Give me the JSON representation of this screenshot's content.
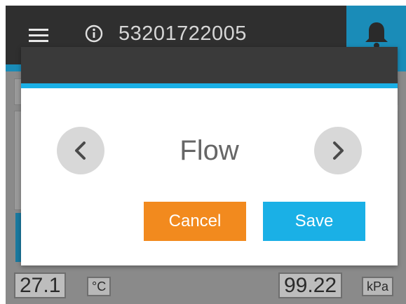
{
  "header": {
    "device_id": "53201722005",
    "menu_icon": "hamburger-menu-icon",
    "info_icon": "info-icon",
    "alert_icon": "bell-icon"
  },
  "dialog": {
    "selection": "Flow",
    "prev_icon": "chevron-left-icon",
    "next_icon": "chevron-right-icon",
    "cancel_label": "Cancel",
    "save_label": "Save"
  },
  "readouts": {
    "temperature": {
      "value": "27.1",
      "unit": "°C"
    },
    "pressure": {
      "value": "99.22",
      "unit": "kPa"
    }
  },
  "colors": {
    "header_bg": "#2f2f2f",
    "accent_blue": "#1ab0e6",
    "cancel_orange": "#f28a1e",
    "nav_button_grey": "#d8d8d8"
  }
}
